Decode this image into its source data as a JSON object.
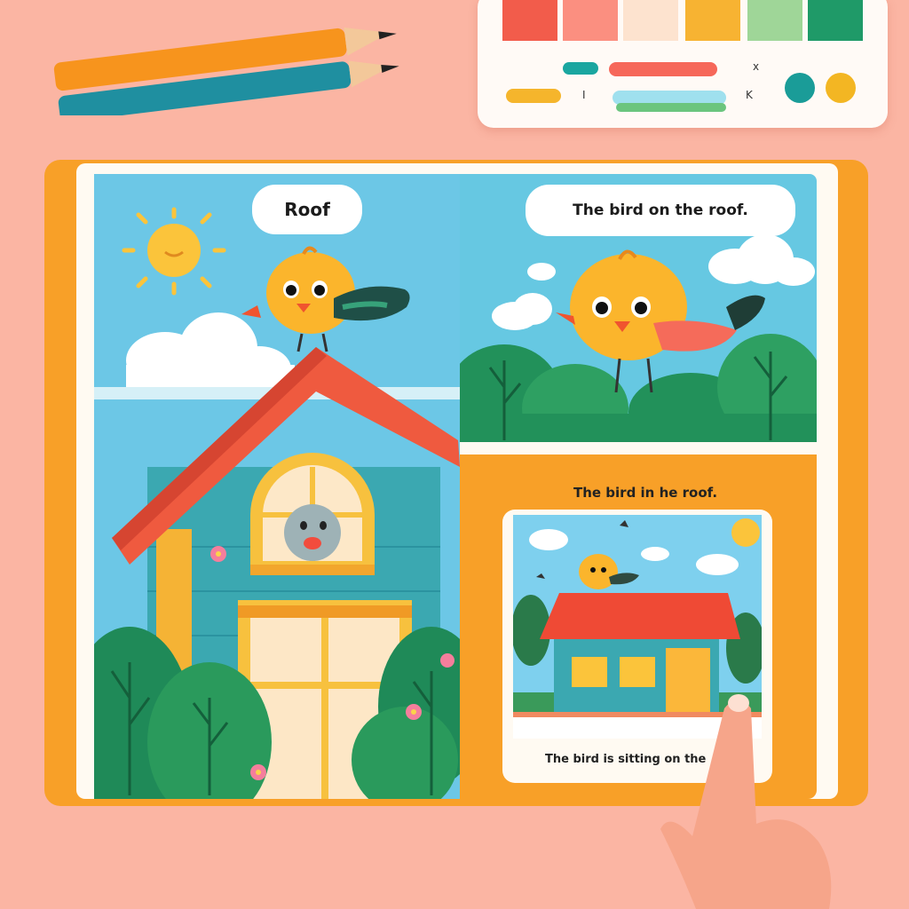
{
  "palette": {
    "swatch_colors": [
      "#f25c4b",
      "#fb8f80",
      "#fde3cf",
      "#f7b332",
      "#9fd698",
      "#1f9a68"
    ],
    "marks": [
      "x",
      "I",
      "K"
    ],
    "dot_colors": [
      "#1a9c98",
      "#f3b623"
    ]
  },
  "book": {
    "left_page": {
      "speech_label": "Roof"
    },
    "right_top": {
      "speech_label": "The bird on the roof."
    },
    "right_bottom": {
      "heading": "The bird in he roof.",
      "caption": "The bird is sitting on the"
    }
  },
  "icons": [
    "pencil-icon",
    "sun-icon",
    "cloud-icon",
    "bird-icon",
    "house-icon",
    "tree-icon",
    "flower-icon",
    "hand-icon"
  ]
}
